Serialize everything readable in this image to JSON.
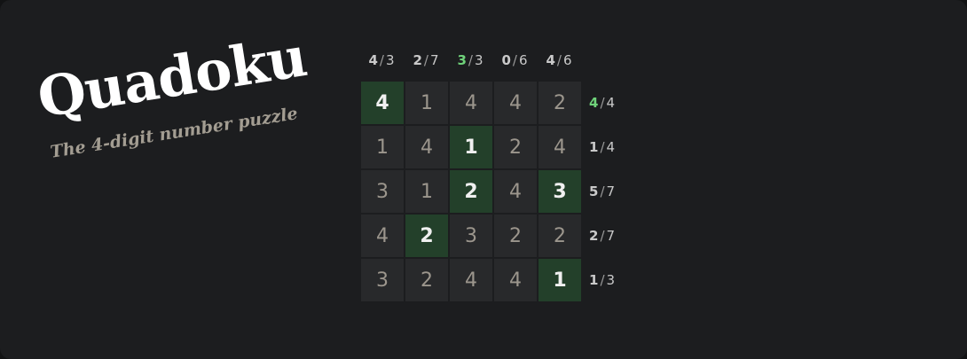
{
  "title": "Quadoku",
  "subtitle": "The 4-digit number puzzle",
  "colors": {
    "background": "#1c1d1f",
    "cell": "#28292b",
    "cell_selected": "#23402a",
    "solved_count": "#6fd27a"
  },
  "columns": [
    {
      "selected": "4",
      "target": "3",
      "solved": false
    },
    {
      "selected": "2",
      "target": "7",
      "solved": false
    },
    {
      "selected": "3",
      "target": "3",
      "solved": true
    },
    {
      "selected": "0",
      "target": "6",
      "solved": false
    },
    {
      "selected": "4",
      "target": "6",
      "solved": false
    }
  ],
  "rows": [
    {
      "selected": "4",
      "target": "4",
      "solved": true
    },
    {
      "selected": "1",
      "target": "4",
      "solved": false
    },
    {
      "selected": "5",
      "target": "7",
      "solved": false
    },
    {
      "selected": "2",
      "target": "7",
      "solved": false
    },
    {
      "selected": "1",
      "target": "3",
      "solved": false
    }
  ],
  "grid": [
    [
      {
        "v": "4",
        "on": true
      },
      {
        "v": "1",
        "on": false
      },
      {
        "v": "4",
        "on": false
      },
      {
        "v": "4",
        "on": false
      },
      {
        "v": "2",
        "on": false
      }
    ],
    [
      {
        "v": "1",
        "on": false
      },
      {
        "v": "4",
        "on": false
      },
      {
        "v": "1",
        "on": true
      },
      {
        "v": "2",
        "on": false
      },
      {
        "v": "4",
        "on": false
      }
    ],
    [
      {
        "v": "3",
        "on": false
      },
      {
        "v": "1",
        "on": false
      },
      {
        "v": "2",
        "on": true
      },
      {
        "v": "4",
        "on": false
      },
      {
        "v": "3",
        "on": true
      }
    ],
    [
      {
        "v": "4",
        "on": false
      },
      {
        "v": "2",
        "on": true
      },
      {
        "v": "3",
        "on": false
      },
      {
        "v": "2",
        "on": false
      },
      {
        "v": "2",
        "on": false
      }
    ],
    [
      {
        "v": "3",
        "on": false
      },
      {
        "v": "2",
        "on": false
      },
      {
        "v": "4",
        "on": false
      },
      {
        "v": "4",
        "on": false
      },
      {
        "v": "1",
        "on": true
      }
    ]
  ]
}
